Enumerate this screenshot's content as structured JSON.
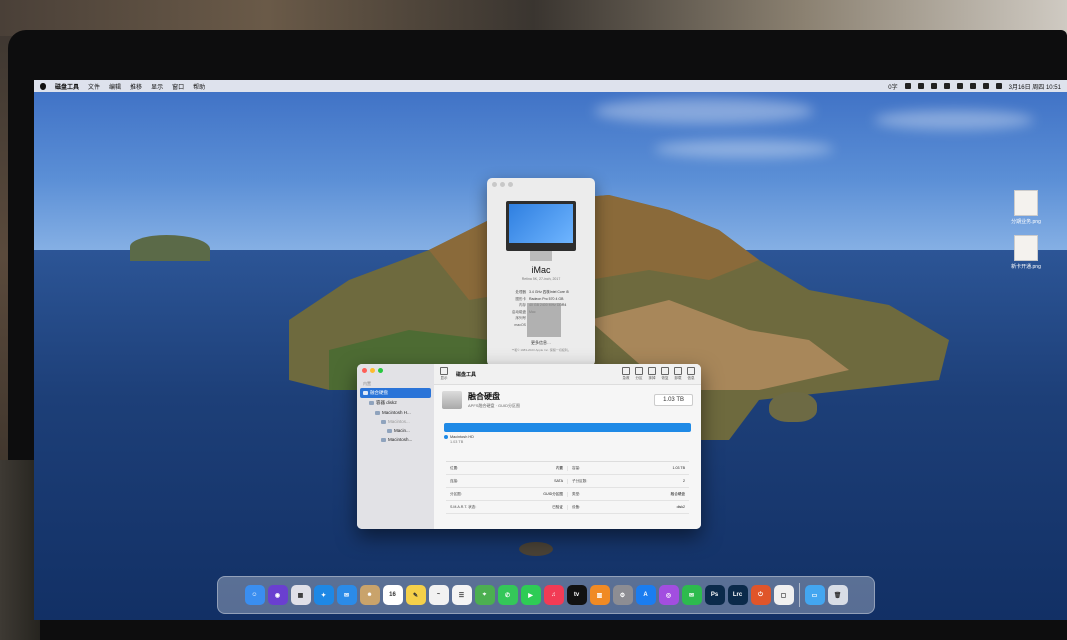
{
  "menubar": {
    "app_name": "磁盘工具",
    "menus": [
      "文件",
      "编辑",
      "推移",
      "显示",
      "窗口",
      "帮助"
    ],
    "status_items": [
      "0字",
      "3月16日 周四 10:51"
    ]
  },
  "desktop": {
    "icons": [
      {
        "label": "分期业务.png"
      },
      {
        "label": "新卡开通.png"
      }
    ]
  },
  "about": {
    "title": "iMac",
    "subtitle": "Retina 5K, 27-inch, 2017",
    "specs": [
      {
        "label": "处理器",
        "value": "3.4 GHz 四核Intel Core i5"
      },
      {
        "label": "图形卡",
        "value": "Radeon Pro 570 4 GB"
      },
      {
        "label": "内存",
        "value": "40 GB 2400 MHz DDR4"
      },
      {
        "label": "启动磁盘",
        "value": "Mac"
      },
      {
        "label": "序列号",
        "value": ""
      },
      {
        "label": "macOS",
        "value": ""
      }
    ],
    "more_button": "更多信息…",
    "copyright": "™和© 1983-2023 Apple Inc. 保留一切权利。"
  },
  "disk_utility": {
    "title": "磁盘工具",
    "sidebar_header": "内置",
    "sidebar": [
      {
        "label": "融合硬盘",
        "selected": true,
        "indent": 0
      },
      {
        "label": "容器 disk2",
        "selected": false,
        "indent": 1
      },
      {
        "label": "Macintosh H...",
        "selected": false,
        "indent": 2
      },
      {
        "label": "Macintos...",
        "selected": false,
        "indent": 3
      },
      {
        "label": "Macin...",
        "selected": false,
        "indent": 4
      },
      {
        "label": "Macintosh...",
        "selected": false,
        "indent": 3
      }
    ],
    "toolbar": [
      {
        "label": "急救",
        "icon": "stethoscope-icon"
      },
      {
        "label": "分区",
        "icon": "partition-icon"
      },
      {
        "label": "抹掉",
        "icon": "erase-icon"
      },
      {
        "label": "恢复",
        "icon": "restore-icon"
      },
      {
        "label": "卸载",
        "icon": "unmount-icon"
      },
      {
        "label": "信息",
        "icon": "info-icon"
      }
    ],
    "view_label": "显示",
    "volume_name": "融合硬盘",
    "volume_sub": "APFS融合硬盘 · GUID分区图",
    "capacity": "1.03 TB",
    "usage_fraction": 1.0,
    "legend_name": "Macintosh HD",
    "legend_size": "1.03 TB",
    "info": [
      [
        {
          "k": "位置:",
          "v": "内置"
        },
        {
          "k": "容量:",
          "v": "1.03 TB"
        }
      ],
      [
        {
          "k": "连接:",
          "v": "SATA"
        },
        {
          "k": "子分区数:",
          "v": "2"
        }
      ],
      [
        {
          "k": "分区图:",
          "v": "GUID分区图"
        },
        {
          "k": "类型:",
          "v": "融合硬盘"
        }
      ],
      [
        {
          "k": "S.M.A.R.T. 状态:",
          "v": "已验证"
        },
        {
          "k": "设备:",
          "v": "disk2"
        }
      ]
    ]
  },
  "dock": {
    "items": [
      {
        "name": "finder",
        "glyph": "☺",
        "color": "#3a8ef0"
      },
      {
        "name": "siri",
        "glyph": "◉",
        "color": "#6a3fd0"
      },
      {
        "name": "launchpad",
        "glyph": "▦",
        "color": "#e0e0e8"
      },
      {
        "name": "safari",
        "glyph": "✦",
        "color": "#1e88e5"
      },
      {
        "name": "mail",
        "glyph": "✉",
        "color": "#2b8be8"
      },
      {
        "name": "contacts",
        "glyph": "☻",
        "color": "#c9a36b"
      },
      {
        "name": "calendar",
        "glyph": "16",
        "color": "#ffffff"
      },
      {
        "name": "notes",
        "glyph": "✎",
        "color": "#f5d04a"
      },
      {
        "name": "freeform",
        "glyph": "~",
        "color": "#f2f2f2"
      },
      {
        "name": "reminders",
        "glyph": "☰",
        "color": "#f4f4f4"
      },
      {
        "name": "maps",
        "glyph": "⌖",
        "color": "#4caf50"
      },
      {
        "name": "messages",
        "glyph": "✆",
        "color": "#34c759"
      },
      {
        "name": "facetime",
        "glyph": "▶",
        "color": "#2ecc55"
      },
      {
        "name": "music",
        "glyph": "♫",
        "color": "#f23b55"
      },
      {
        "name": "tv",
        "glyph": "tv",
        "color": "#111111"
      },
      {
        "name": "books",
        "glyph": "▥",
        "color": "#f08a24"
      },
      {
        "name": "system-settings",
        "glyph": "⚙",
        "color": "#8d8d93"
      },
      {
        "name": "app-store",
        "glyph": "A",
        "color": "#1b7df0"
      },
      {
        "name": "podcasts",
        "glyph": "◎",
        "color": "#a24ee0"
      },
      {
        "name": "wechat",
        "glyph": "✉",
        "color": "#2dbb4e"
      },
      {
        "name": "photoshop",
        "glyph": "Ps",
        "color": "#0b2a4a"
      },
      {
        "name": "lightroom-classic",
        "glyph": "Lrc",
        "color": "#0b2a4a"
      },
      {
        "name": "power-app",
        "glyph": "⏻",
        "color": "#e0552a"
      },
      {
        "name": "preview",
        "glyph": "▢",
        "color": "#f0f0f0"
      }
    ],
    "right_items": [
      {
        "name": "downloads-folder",
        "glyph": "▭",
        "color": "#43a6f0"
      },
      {
        "name": "trash",
        "glyph": "🗑",
        "color": "#d8dde6"
      }
    ]
  }
}
